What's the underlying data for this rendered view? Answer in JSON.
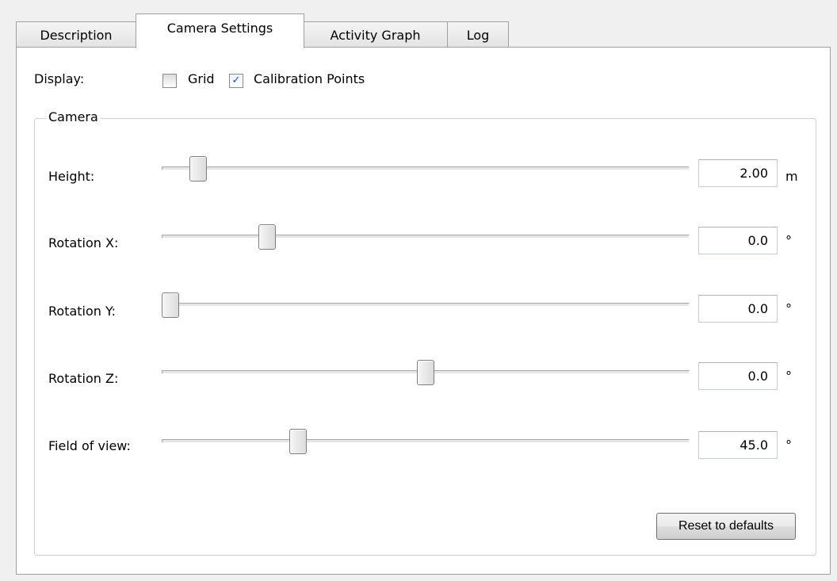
{
  "tabs": [
    {
      "label": "Description"
    },
    {
      "label": "Camera Settings",
      "active": true
    },
    {
      "label": "Activity Graph"
    },
    {
      "label": "Log"
    }
  ],
  "display": {
    "label": "Display:",
    "options": [
      {
        "label": "Grid",
        "checked": false
      },
      {
        "label": "Calibration Points",
        "checked": true
      }
    ]
  },
  "camera": {
    "title": "Camera",
    "rows": [
      {
        "label": "Height:",
        "value": "2.00",
        "unit": "m",
        "slider_fraction": 0.055
      },
      {
        "label": "Rotation X:",
        "value": "0.0",
        "unit": "°",
        "slider_fraction": 0.19
      },
      {
        "label": "Rotation Y:",
        "value": "0.0",
        "unit": "°",
        "slider_fraction": 0.0
      },
      {
        "label": "Rotation Z:",
        "value": "0.0",
        "unit": "°",
        "slider_fraction": 0.5
      },
      {
        "label": "Field of view:",
        "value": "45.0",
        "unit": "°",
        "slider_fraction": 0.25
      }
    ],
    "reset_label": "Reset to defaults"
  },
  "icons": {
    "checkmark": "checkmark-icon"
  }
}
